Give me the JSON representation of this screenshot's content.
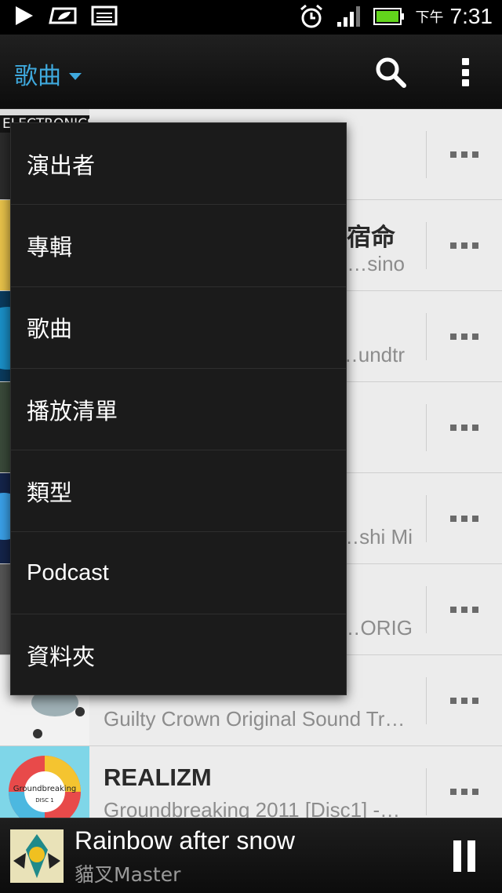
{
  "status_bar": {
    "icons": [
      "play-icon",
      "eco-leaf-icon",
      "image-icon",
      "alarm-icon",
      "signal-icon",
      "battery-icon"
    ],
    "ampm": "下午",
    "time": "7:31",
    "battery_color": "#62d41c"
  },
  "action_bar": {
    "title": "歌曲",
    "accent": "#3fa9dd"
  },
  "songs": [
    {
      "title": "",
      "subtitle": ""
    },
    {
      "title": "宿命",
      "subtitle": "sino…"
    },
    {
      "title": "",
      "subtitle": "undtr…"
    },
    {
      "title": "",
      "subtitle": ""
    },
    {
      "title": "",
      "subtitle": "shi Mi…"
    },
    {
      "title": "",
      "subtitle": "ORIG…"
    },
    {
      "title": "",
      "subtitle": "Guilty Crown Original Sound Tr…"
    },
    {
      "title": "REALIZM",
      "subtitle": "Groundbreaking 2011 [Disc1] -…"
    }
  ],
  "album_art": {
    "first": "ELECTRONICS",
    "last_title": "Groundbreaking",
    "last_disc": "DISC 1"
  },
  "menu": {
    "items": [
      "演出者",
      "專輯",
      "歌曲",
      "播放清單",
      "類型",
      "Podcast",
      "資料夾"
    ]
  },
  "now_playing": {
    "title": "Rainbow after snow",
    "artist": "貓叉Master"
  }
}
